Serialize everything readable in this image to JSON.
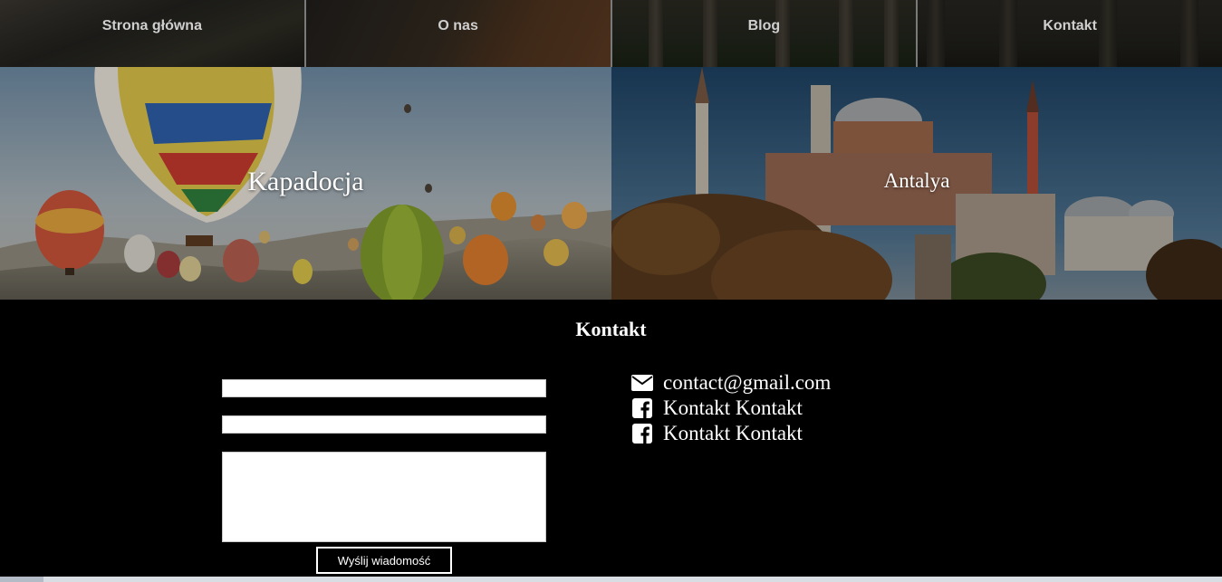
{
  "nav": {
    "items": [
      {
        "label": "Strona główna"
      },
      {
        "label": "O nas"
      },
      {
        "label": "Blog"
      },
      {
        "label": "Kontakt"
      }
    ]
  },
  "hero": {
    "left": {
      "title": "Kapadocja"
    },
    "right": {
      "title": "Antalya"
    }
  },
  "contact": {
    "title": "Kontakt",
    "form": {
      "field1_value": "",
      "field2_value": "",
      "message_value": "",
      "submit_label": "Wyślij wiadomość"
    },
    "info": [
      {
        "icon": "envelope-icon",
        "text": "contact@gmail.com"
      },
      {
        "icon": "facebook-icon",
        "text": "Kontakt Kontakt"
      },
      {
        "icon": "facebook-icon",
        "text": "Kontakt Kontakt"
      }
    ]
  },
  "colors": {
    "background": "#000000",
    "text": "#ffffff",
    "nav_text": "#cfcfcf"
  }
}
